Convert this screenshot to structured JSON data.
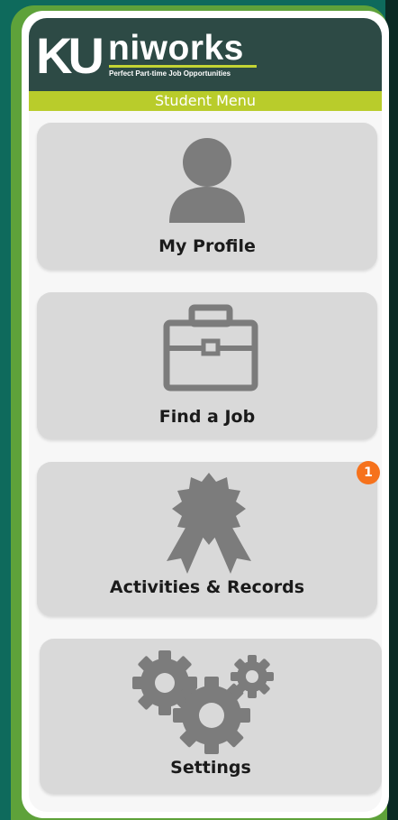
{
  "app": {
    "logo_ku": "KU",
    "logo_niworks": "niworks",
    "tagline": "Perfect Part-time Job Opportunities"
  },
  "menu": {
    "title": "Student Menu",
    "items": [
      {
        "label": "My Profile",
        "icon": "person-icon"
      },
      {
        "label": "Find a Job",
        "icon": "briefcase-icon"
      },
      {
        "label": "Activities & Records",
        "icon": "award-ribbon-icon",
        "badge": "1"
      },
      {
        "label": "Settings",
        "icon": "gears-icon"
      }
    ]
  },
  "colors": {
    "header_bg": "#2d4a45",
    "accent_green": "#b9cc2b",
    "card_bg": "#d9d9d9",
    "icon_gray": "#7c7c7c",
    "badge": "#f6721c",
    "outer_bg": "#0e6a5c"
  }
}
